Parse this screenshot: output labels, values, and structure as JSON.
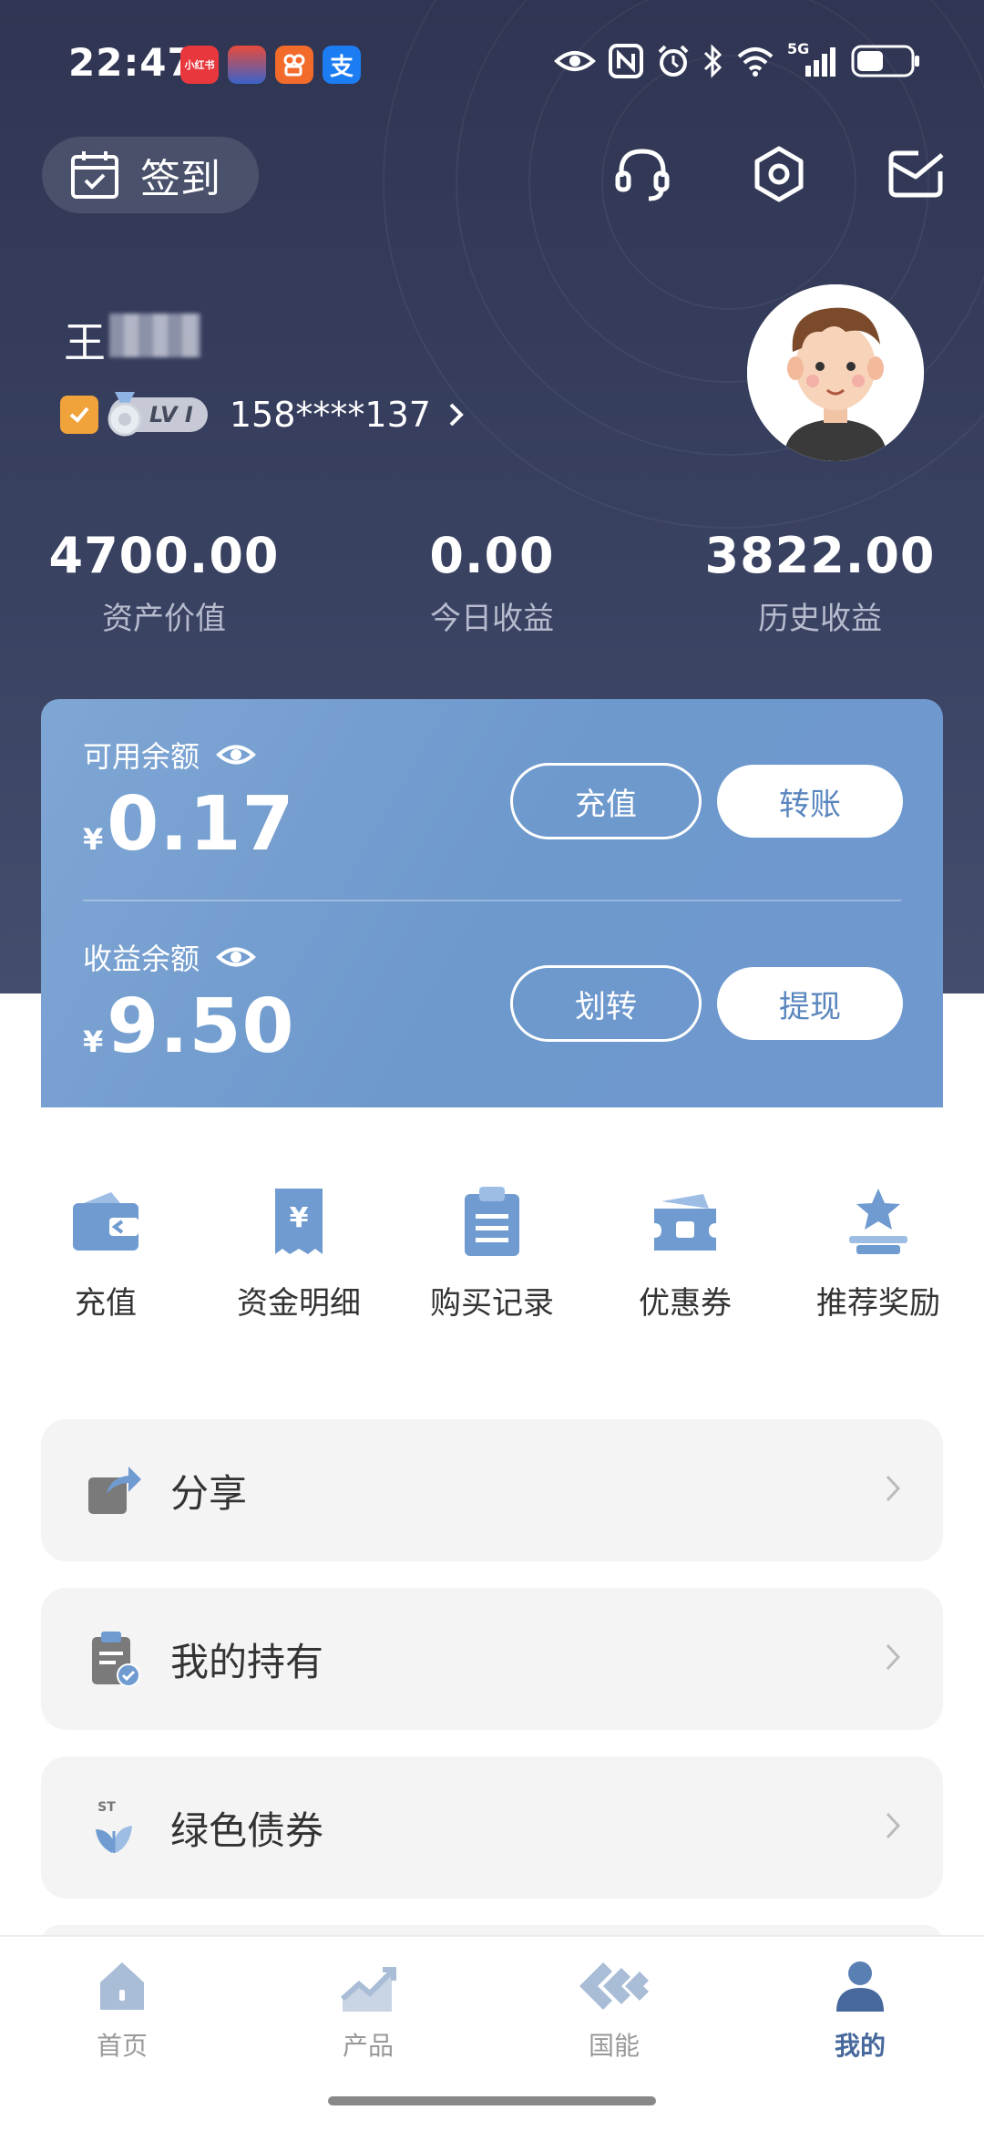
{
  "status_bar": {
    "time": "22:47",
    "app_badges": [
      {
        "name": "xiaohongshu",
        "text": "小红书",
        "color": "#e8383d"
      },
      {
        "name": "taobao-event",
        "text": "",
        "color": "#d9403c"
      },
      {
        "name": "kuaishou",
        "text": "",
        "color": "#f26b2b"
      },
      {
        "name": "alipay",
        "text": "支",
        "color": "#1c7cf2"
      }
    ],
    "network": "5G"
  },
  "header": {
    "signin_label": "签到",
    "icons": [
      "headset-icon",
      "settings-icon",
      "mail-icon"
    ]
  },
  "profile": {
    "name_first_char": "王",
    "level": "LV I",
    "phone": "158****137"
  },
  "stats": [
    {
      "value": "4700.00",
      "label": "资产价值"
    },
    {
      "value": "0.00",
      "label": "今日收益"
    },
    {
      "value": "3822.00",
      "label": "历史收益"
    }
  ],
  "balance": {
    "available": {
      "label": "可用余额",
      "currency": "¥",
      "amount": "0.17",
      "btn1": "充值",
      "btn2": "转账"
    },
    "earnings": {
      "label": "收益余额",
      "currency": "¥",
      "amount": "9.50",
      "btn1": "划转",
      "btn2": "提现"
    }
  },
  "quick_actions": [
    {
      "label": "充值",
      "icon": "wallet-icon"
    },
    {
      "label": "资金明细",
      "icon": "receipt-icon"
    },
    {
      "label": "购买记录",
      "icon": "clipboard-list-icon"
    },
    {
      "label": "优惠券",
      "icon": "coupon-icon"
    },
    {
      "label": "推荐奖励",
      "icon": "star-award-icon"
    }
  ],
  "menu": [
    {
      "label": "分享",
      "icon": "share-icon"
    },
    {
      "label": "我的持有",
      "icon": "holdings-icon"
    },
    {
      "label": "绿色债券",
      "icon": "green-bond-icon"
    }
  ],
  "bottom_nav": [
    {
      "label": "首页",
      "icon": "home-icon",
      "active": false
    },
    {
      "label": "产品",
      "icon": "chart-icon",
      "active": false
    },
    {
      "label": "国能",
      "icon": "brand-icon",
      "active": false
    },
    {
      "label": "我的",
      "icon": "profile-icon",
      "active": true
    }
  ],
  "colors": {
    "header_dark": "#2f3552",
    "card_blue": "#6e99cd",
    "icon_blue": "#6f9bd1",
    "nav_active": "#46689c"
  }
}
